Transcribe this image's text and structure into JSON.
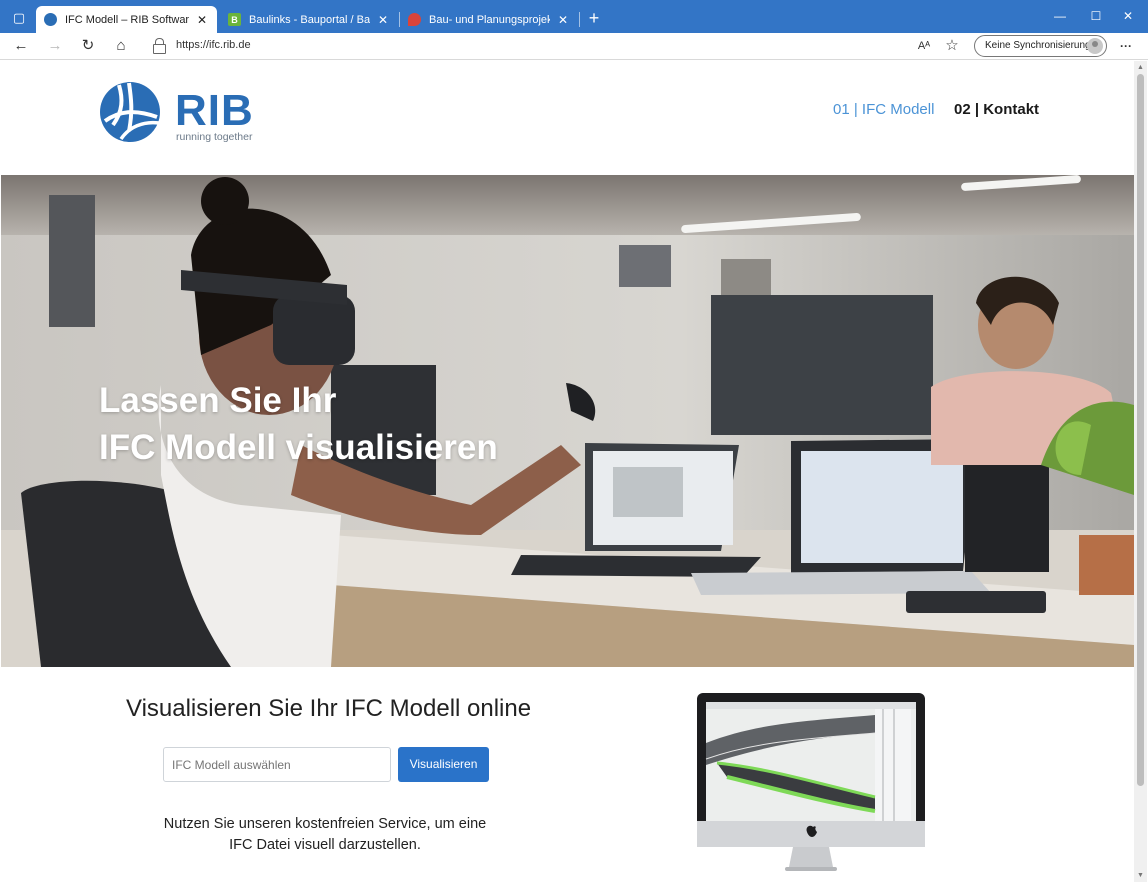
{
  "browser": {
    "tabs": [
      {
        "title": "IFC Modell – RIB Software",
        "active": true,
        "favicon_color": "#2a6db5"
      },
      {
        "title": "Baulinks - Bauportal / Baumagazin",
        "active": false,
        "favicon_color": "#6bb43c",
        "favicon_letter": "B"
      },
      {
        "title": "Bau- und Planungsprojekte auf Baunetz",
        "active": false,
        "favicon_color": "#d9443a"
      }
    ],
    "url": "https://ifc.rib.de",
    "sync_label": "Keine Synchronisierung",
    "close_glyph": "✕",
    "newtab_glyph": "+",
    "back_glyph": "←",
    "forward_glyph": "→",
    "reload_glyph": "↻",
    "home_glyph": "⌂",
    "read_aloud_glyph": "Aᴬ",
    "favorites_glyph": "☆",
    "more_glyph": "···",
    "minimize_glyph": "—",
    "maximize_glyph": "☐",
    "window_close_glyph": "✕"
  },
  "site": {
    "logo": {
      "word": "RIB",
      "tagline": "running together",
      "color": "#2a6db5"
    },
    "nav": [
      {
        "label": "01 | IFC Modell",
        "active": true
      },
      {
        "label": "02 | Kontakt",
        "active": false
      }
    ],
    "hero": {
      "line1": "Lassen Sie Ihr",
      "line2": "IFC Modell visualisieren"
    },
    "section_title": "Visualisieren Sie Ihr IFC Modell online",
    "file_input_placeholder": "IFC Modell auswählen",
    "button_label": "Visualisieren",
    "description_line1": "Nutzen Sie unseren kostenfreien Service, um eine",
    "description_line2": "IFC Datei visuell darzustellen.",
    "accent_color": "#2a73c9"
  }
}
